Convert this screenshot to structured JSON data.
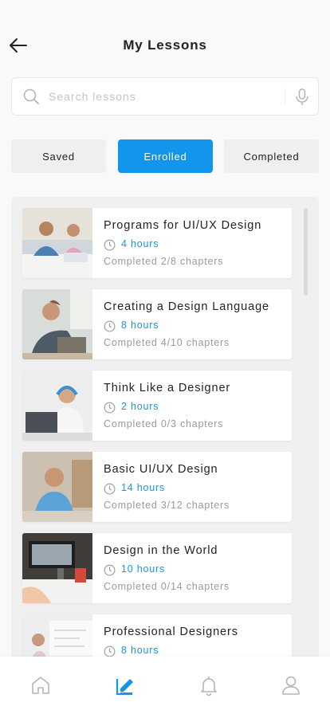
{
  "header": {
    "title": "My Lessons"
  },
  "search": {
    "placeholder": "Search lessons",
    "value": ""
  },
  "tabs": [
    {
      "label": "Saved",
      "active": false
    },
    {
      "label": "Enrolled",
      "active": true
    },
    {
      "label": "Completed",
      "active": false
    }
  ],
  "lessons": [
    {
      "title": "Programs for UI/UX Design",
      "hours": "4 hours",
      "progress": "Completed 2/8 chapters"
    },
    {
      "title": "Creating a Design Language",
      "hours": "8 hours",
      "progress": "Completed 4/10 chapters"
    },
    {
      "title": "Think Like a Designer",
      "hours": "2 hours",
      "progress": "Completed 0/3 chapters"
    },
    {
      "title": "Basic UI/UX Design",
      "hours": "14 hours",
      "progress": "Completed 3/12 chapters"
    },
    {
      "title": "Design in the World",
      "hours": "10 hours",
      "progress": "Completed 0/14 chapters"
    },
    {
      "title": "Professional Designers",
      "hours": "8 hours",
      "progress": ""
    }
  ],
  "bottom_nav": {
    "items": [
      "home-icon",
      "lessons-icon",
      "bell-icon",
      "profile-icon"
    ],
    "active": "lessons-icon"
  },
  "colors": {
    "accent": "#1196ec",
    "muted": "#9a9a9a",
    "tab_bg": "#efefef",
    "panel_bg": "#f0f0f0"
  }
}
